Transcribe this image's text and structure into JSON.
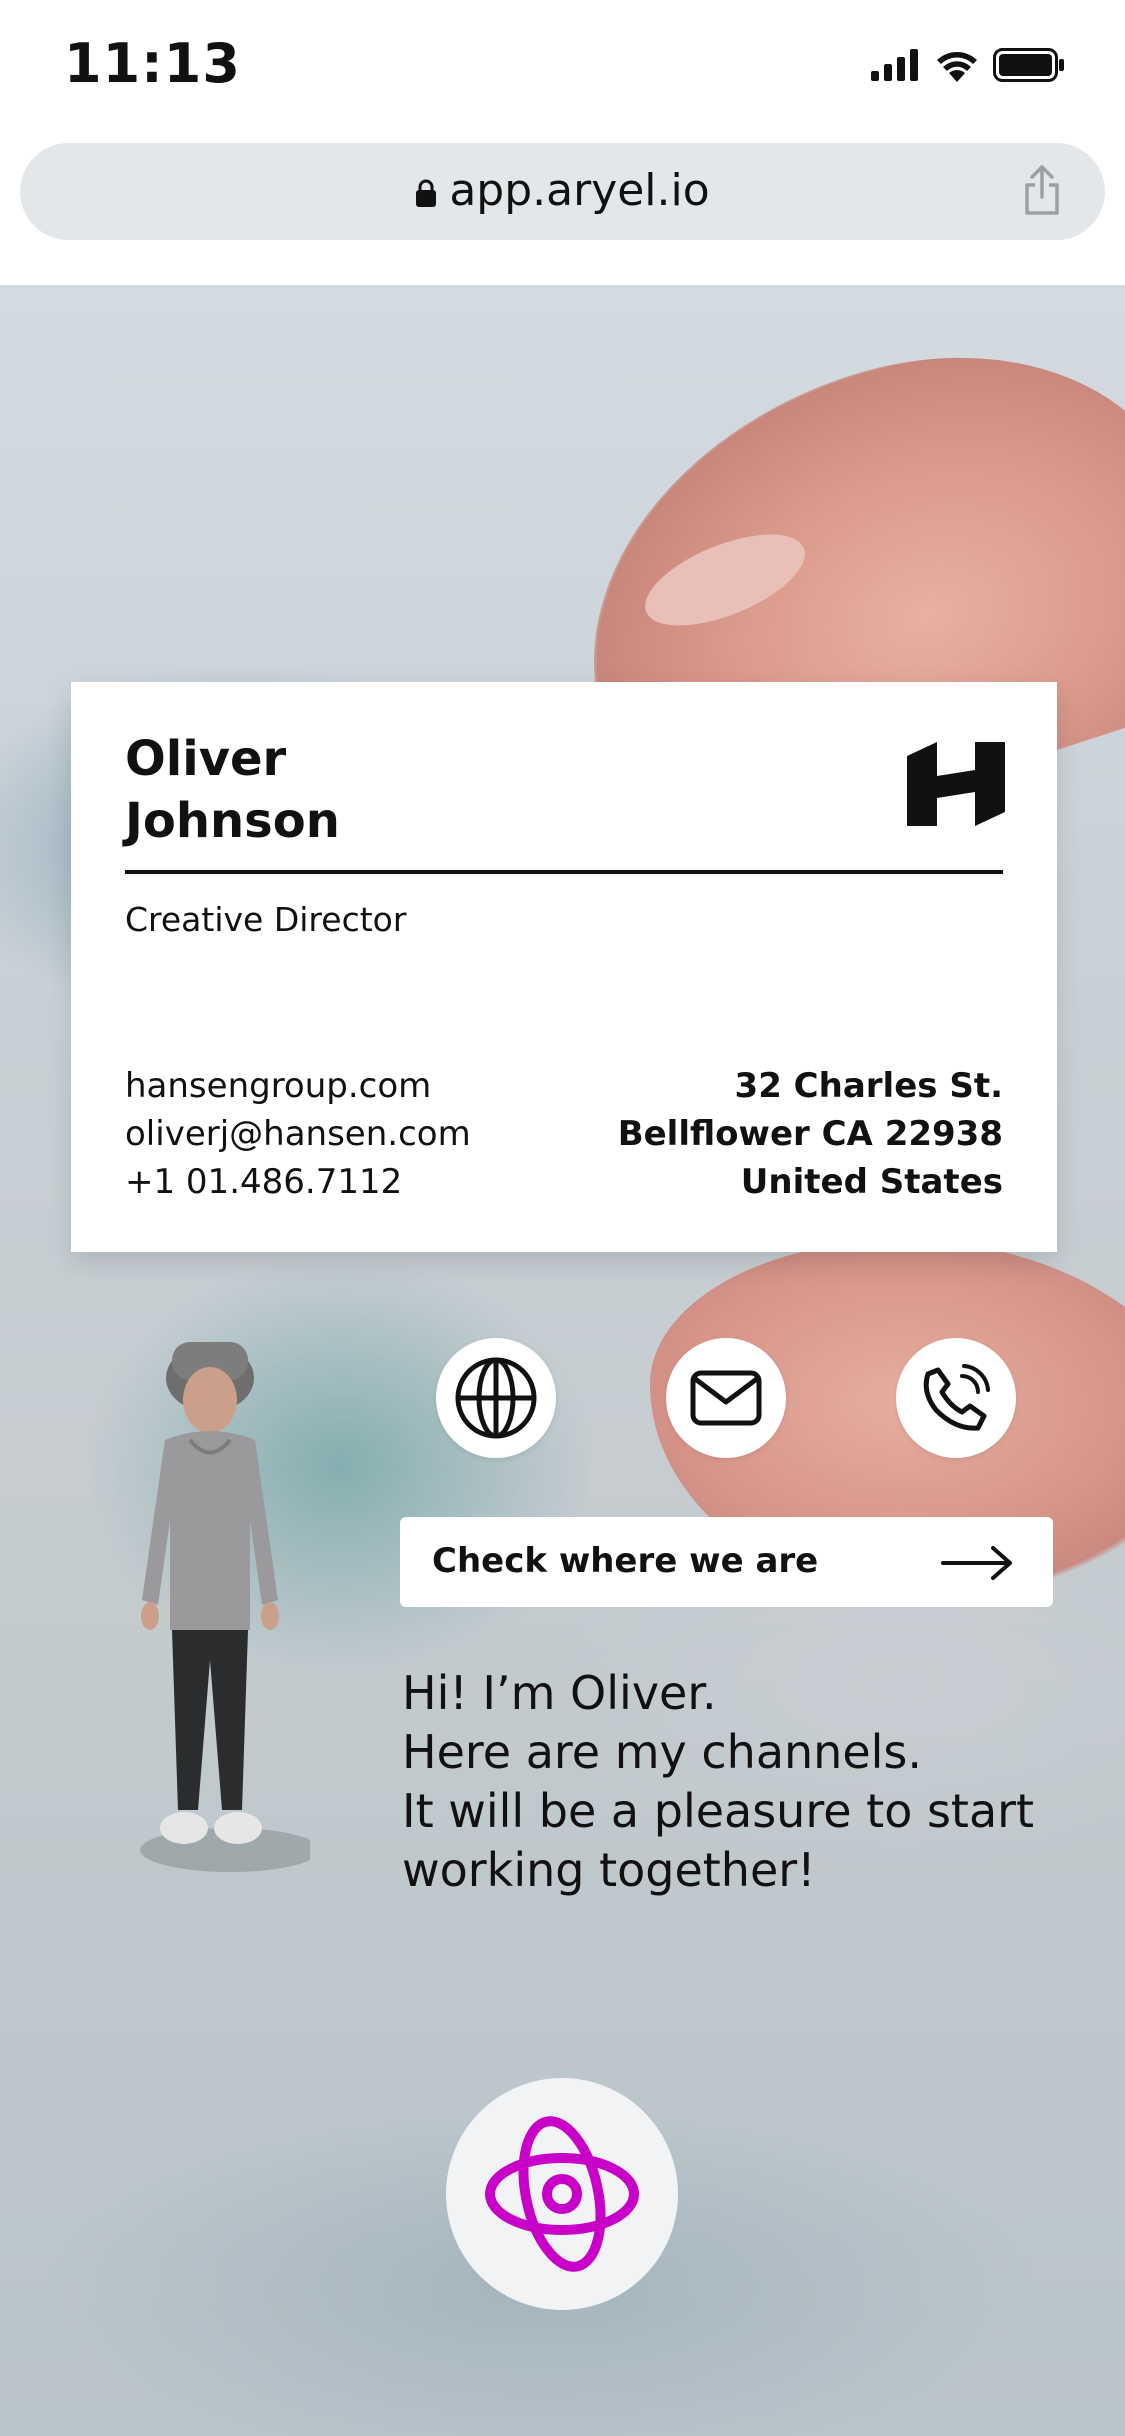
{
  "status_bar": {
    "time": "11:13"
  },
  "browser": {
    "url": "app.aryel.io"
  },
  "card": {
    "first_name": "Oliver",
    "last_name": "Johnson",
    "title": "Creative Director",
    "website": "hansengroup.com",
    "email": "oliverj@hansen.com",
    "phone": "+1 01.486.7112",
    "address_line1": "32 Charles St.",
    "address_line2": "Bellflower CA 22938",
    "address_line3": "United States"
  },
  "cta": {
    "label": "Check where we are"
  },
  "message": {
    "line1": "Hi! I’m Oliver.",
    "line2": "Here are my channels.",
    "line3": "It will be a pleasure to start",
    "line4": "working together!"
  },
  "icons": {
    "website": "globe-icon",
    "email": "envelope-icon",
    "phone": "phone-icon",
    "brand": "aryel-logo-icon"
  },
  "colors": {
    "brand_accent": "#c800c8",
    "card_bg": "#ffffff",
    "text": "#111111"
  }
}
